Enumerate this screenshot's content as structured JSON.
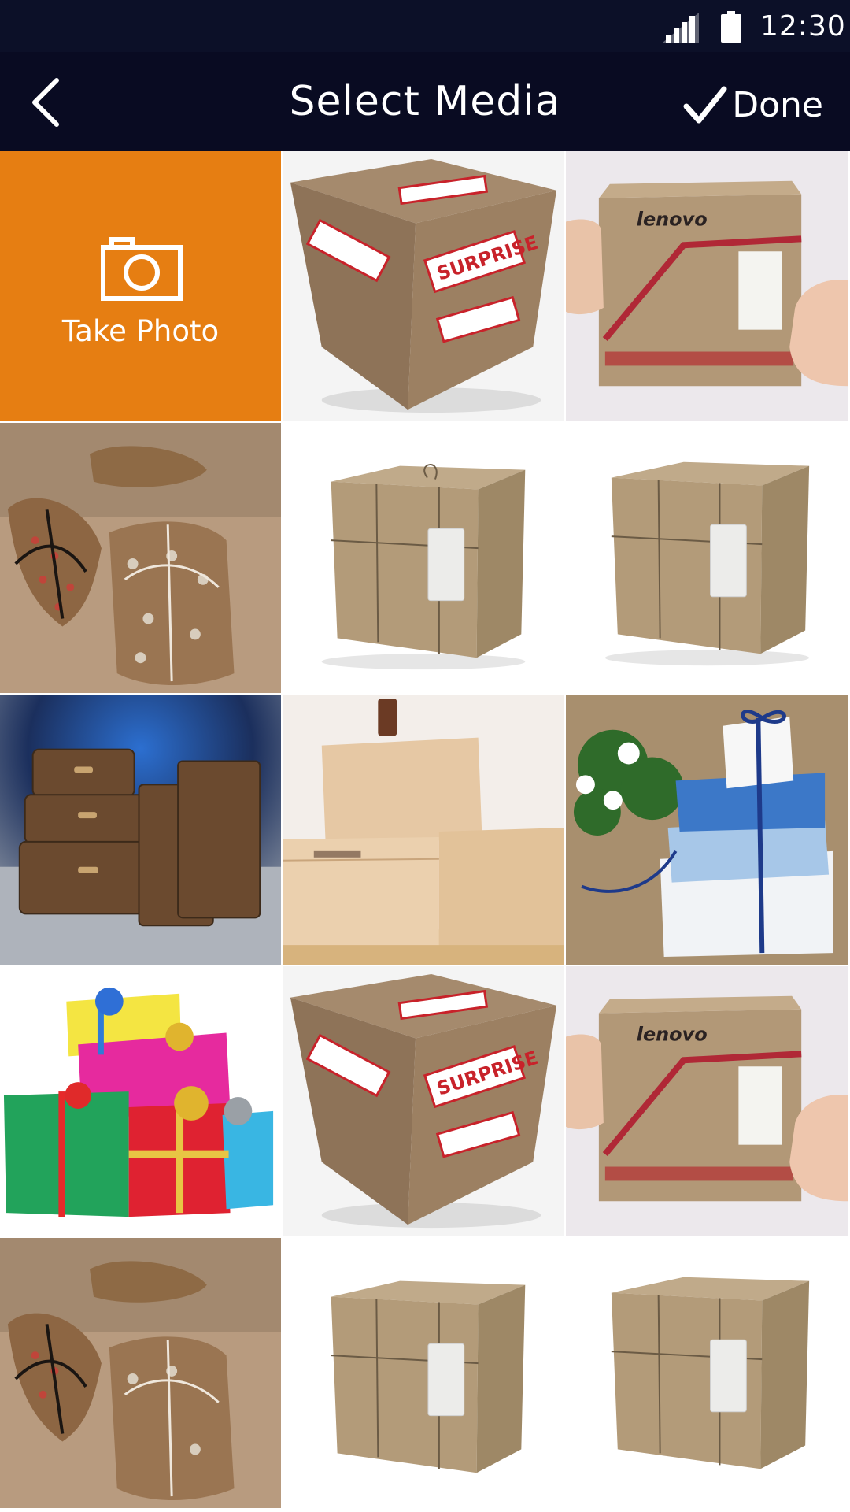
{
  "status_bar": {
    "time": "12:30"
  },
  "app_bar": {
    "title": "Select Media",
    "done_label": "Done"
  },
  "take_photo": {
    "label": "Take Photo"
  },
  "gallery": [
    {
      "subject": "surprise-box"
    },
    {
      "subject": "lenovo-box"
    },
    {
      "subject": "pillow-gift-boxes"
    },
    {
      "subject": "kraft-parcel-with-tag"
    },
    {
      "subject": "kraft-parcel-with-tag"
    },
    {
      "subject": "vintage-trunks"
    },
    {
      "subject": "cardboard-boxes"
    },
    {
      "subject": "blue-white-gifts-with-flowers"
    },
    {
      "subject": "colorful-gift-stack"
    },
    {
      "subject": "surprise-box"
    },
    {
      "subject": "lenovo-box"
    },
    {
      "subject": "pillow-gift-boxes"
    },
    {
      "subject": "kraft-parcel-with-tag"
    },
    {
      "subject": "kraft-parcel-with-tag"
    }
  ],
  "colors": {
    "status_bar": "#0c1028",
    "app_bar": "#090b22",
    "take_photo_tile": "#e67e12",
    "text_on_dark": "#ffffff"
  }
}
